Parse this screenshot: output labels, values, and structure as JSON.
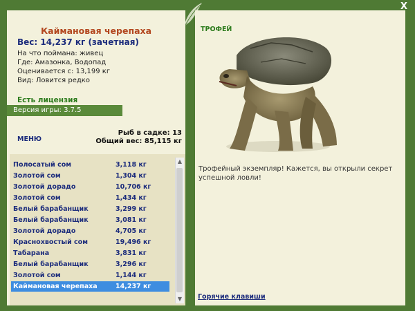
{
  "window": {
    "close_label": "X"
  },
  "fish": {
    "title": "Каймановая черепаха",
    "weight": "Вес: 14,237 кг (зачетная)",
    "bait": "На что поймана: живец",
    "location": "Где: Амазонка, Водопад",
    "value": "Оценивается с: 13,199 кг",
    "rarity": "Вид: Ловится редко"
  },
  "license": "Есть лицензия",
  "version": "Версия игры: 3.7.5",
  "menu_label": "МЕНЮ",
  "stats": {
    "count": "Рыб в садке: 13",
    "total": "Общий вес: 85,115 кг"
  },
  "catch_list": [
    {
      "name": "Полосатый сом",
      "weight": "3,118 кг"
    },
    {
      "name": "Золотой сом",
      "weight": "1,304 кг"
    },
    {
      "name": "Золотой дорадо",
      "weight": "10,706 кг"
    },
    {
      "name": "Золотой сом",
      "weight": "1,434 кг"
    },
    {
      "name": "Белый барабанщик",
      "weight": "3,299 кг"
    },
    {
      "name": "Белый барабанщик",
      "weight": "3,081 кг"
    },
    {
      "name": "Золотой дорадо",
      "weight": "4,705 кг"
    },
    {
      "name": "Краснохвостый сом",
      "weight": "19,496 кг"
    },
    {
      "name": "Табарана",
      "weight": "3,831 кг"
    },
    {
      "name": "Белый барабанщик",
      "weight": "3,296 кг"
    },
    {
      "name": "Золотой сом",
      "weight": "1,144 кг"
    },
    {
      "name": "Каймановая черепаха",
      "weight": "14,237 кг"
    }
  ],
  "selected_index": 11,
  "trophy": {
    "label": "ТРОФЕЙ",
    "text": "Трофейный экземпляр! Кажется, вы открыли секрет успешной ловли!"
  },
  "hotkeys_label": "Горячие клавиши",
  "colors": {
    "frame": "#4f7a34",
    "panel": "#f3f1dc",
    "title": "#b3471f",
    "name": "#1c2c7c",
    "selected": "#3e8de0"
  }
}
